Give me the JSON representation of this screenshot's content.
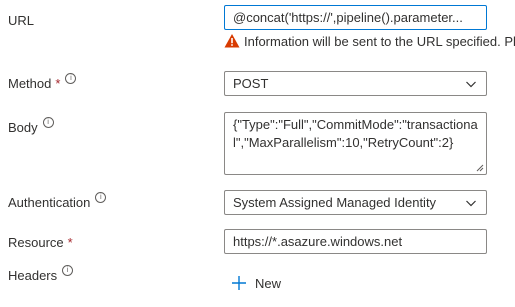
{
  "url": {
    "label": "URL",
    "value": "@concat('https://',pipeline().parameter...",
    "warning": "Information will be sent to the URL specified. Pl"
  },
  "method": {
    "label": "Method",
    "required_mark": "*",
    "info_glyph": "i",
    "value": "POST"
  },
  "body": {
    "label": "Body",
    "info_glyph": "i",
    "value": "{\"Type\":\"Full\",\"CommitMode\":\"transactional\",\"MaxParallelism\":10,\"RetryCount\":2}"
  },
  "authentication": {
    "label": "Authentication",
    "info_glyph": "i",
    "value": "System Assigned Managed Identity"
  },
  "resource": {
    "label": "Resource",
    "required_mark": "*",
    "value": "https://*.asazure.windows.net"
  },
  "headers": {
    "label": "Headers",
    "info_glyph": "i",
    "new_label": "New"
  },
  "colors": {
    "accent": "#0078d4",
    "warning": "#d83b01",
    "required": "#a4262c",
    "border": "#8a8886",
    "text": "#323130"
  },
  "icons": {
    "warning": "warning-triangle-icon",
    "info": "info-circle-icon",
    "chevron": "chevron-down-icon",
    "add": "plus-icon"
  }
}
